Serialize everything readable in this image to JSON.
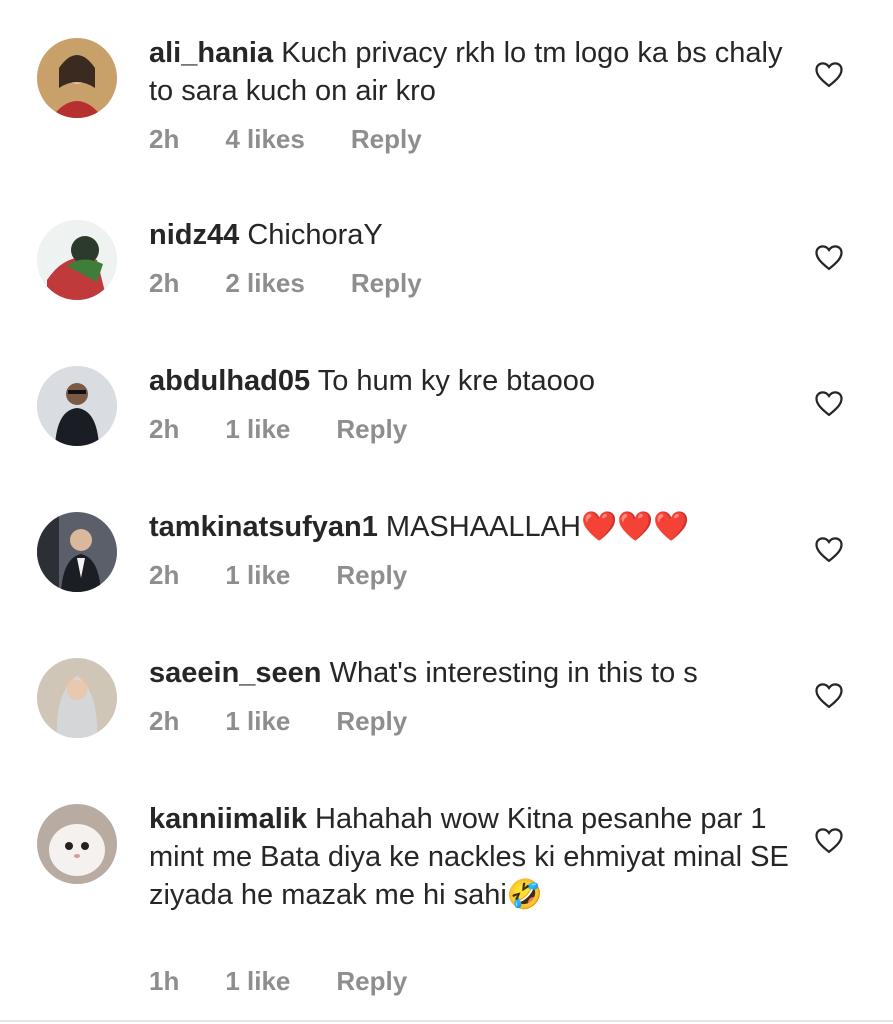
{
  "comments": [
    {
      "username": "ali_hania",
      "text": "Kuch privacy rkh lo tm logo ka bs chaly to sara kuch on air kro",
      "time": "2h",
      "likes": "4 likes",
      "reply": "Reply"
    },
    {
      "username": "nidz44",
      "text": "ChichoraY",
      "time": "2h",
      "likes": "2 likes",
      "reply": "Reply"
    },
    {
      "username": "abdulhad05",
      "text": "To hum ky kre btaooo",
      "time": "2h",
      "likes": "1 like",
      "reply": "Reply"
    },
    {
      "username": "tamkinatsufyan1",
      "text": "MASHAALLAH",
      "emoji": "❤️❤️❤️",
      "time": "2h",
      "likes": "1 like",
      "reply": "Reply"
    },
    {
      "username": "saeein_seen",
      "text": "What's interesting in this to s",
      "time": "2h",
      "likes": "1 like",
      "reply": "Reply"
    },
    {
      "username": "kanniimalik",
      "text": "Hahahah wow Kitna pesanhe par 1 mint me Bata diya ke nackles ki ehmiyat minal SE ziyada he mazak me hi sahi",
      "emoji": "🤣",
      "time": "1h",
      "likes": "1 like",
      "reply": "Reply"
    }
  ],
  "colors": {
    "text": "#262626",
    "meta": "#8e8e8e",
    "heart_emoji": "#e0242b"
  },
  "icons": {
    "like": "heart-outline-icon"
  }
}
